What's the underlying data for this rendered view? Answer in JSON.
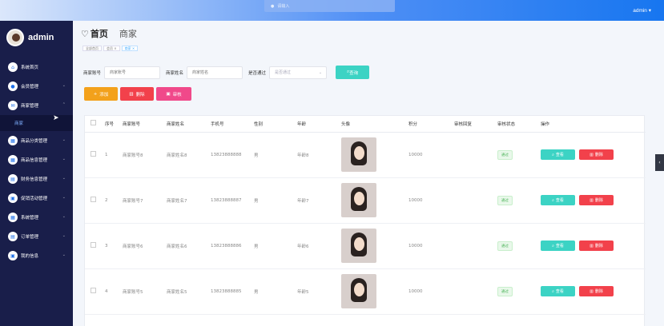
{
  "header": {
    "search_placeholder": "请输入",
    "user": "admin ▾"
  },
  "sidebar": {
    "brand": "admin",
    "items": [
      {
        "label": "系统首页",
        "icon": "home-icon",
        "arrow": ""
      },
      {
        "label": "会员管理",
        "icon": "user-icon",
        "arrow": "⌄"
      },
      {
        "label": "商家管理",
        "icon": "shop-icon",
        "arrow": "⌃"
      },
      {
        "label": "商品分类管理",
        "icon": "category-icon",
        "arrow": "⌄"
      },
      {
        "label": "商品信息管理",
        "icon": "goods-icon",
        "arrow": "⌄"
      },
      {
        "label": "财务信息管理",
        "icon": "finance-icon",
        "arrow": "⌄"
      },
      {
        "label": "促销活动管理",
        "icon": "promo-icon",
        "arrow": "⌄"
      },
      {
        "label": "系统管理",
        "icon": "settings-icon",
        "arrow": "⌄"
      },
      {
        "label": "订单管理",
        "icon": "order-icon",
        "arrow": "⌄"
      },
      {
        "label": "我的信息",
        "icon": "profile-icon",
        "arrow": "⌄"
      }
    ],
    "sub_item": "商家"
  },
  "page": {
    "home": "首页",
    "current": "商家",
    "breadcrumbs": [
      "全部首页",
      "会员 ×",
      "商家 ×"
    ]
  },
  "search": {
    "merchant_account_label": "商家账号",
    "merchant_account_placeholder": "商家账号",
    "merchant_name_label": "商家姓名",
    "merchant_name_placeholder": "商家姓名",
    "approved_label": "是否通过",
    "approved_placeholder": "是否通过",
    "query_button": "查询"
  },
  "actions": {
    "add": "添加",
    "delete": "删除",
    "audit": "审核"
  },
  "table": {
    "headers": [
      "序号",
      "商家账号",
      "商家姓名",
      "手机号",
      "性别",
      "年龄",
      "头像",
      "积分",
      "审核回复",
      "审核状态",
      "操作"
    ],
    "rows": [
      {
        "index": "1",
        "account": "商家账号8",
        "name": "商家姓名8",
        "phone": "13823888888",
        "gender": "男",
        "age": "年龄8",
        "points": "10000",
        "reply": "",
        "status": "通过"
      },
      {
        "index": "2",
        "account": "商家账号7",
        "name": "商家姓名7",
        "phone": "13823888887",
        "gender": "男",
        "age": "年龄7",
        "points": "10000",
        "reply": "",
        "status": "通过"
      },
      {
        "index": "3",
        "account": "商家账号6",
        "name": "商家姓名6",
        "phone": "13823888886",
        "gender": "男",
        "age": "年龄6",
        "points": "10000",
        "reply": "",
        "status": "通过"
      },
      {
        "index": "4",
        "account": "商家账号5",
        "name": "商家姓名5",
        "phone": "13823888885",
        "gender": "男",
        "age": "年龄5",
        "points": "10000",
        "reply": "",
        "status": "通过"
      }
    ],
    "view_button": "查看",
    "delete_button": "删除"
  },
  "colors": {
    "sidebar": "#191e4a",
    "primary": "#3cd3c4",
    "danger": "#f2414b",
    "warning": "#f3a11b",
    "pink": "#f0498a"
  }
}
